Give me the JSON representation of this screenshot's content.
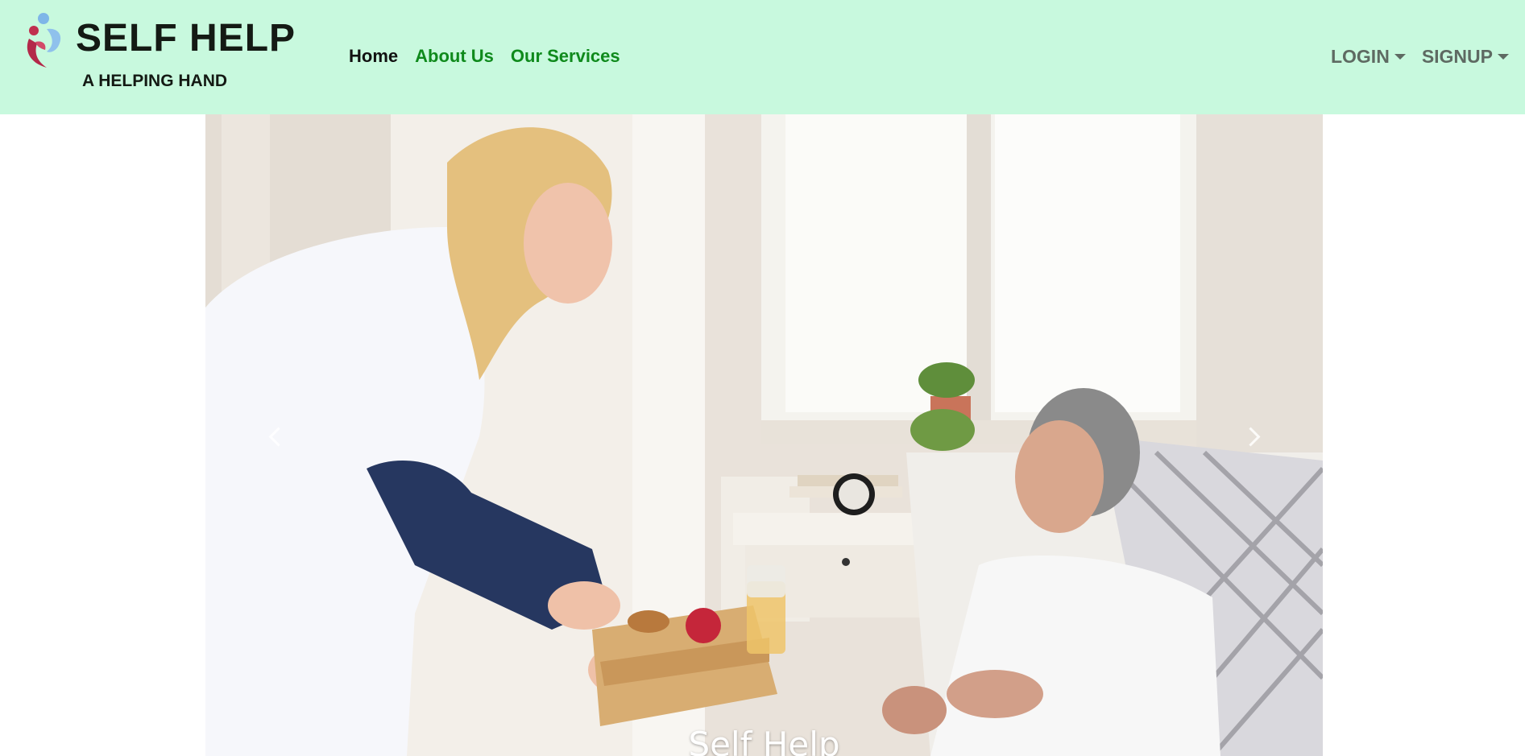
{
  "brand": {
    "title": "SELF HELP",
    "tagline": "A HELPING HAND",
    "logo_icon": "people-helping-icon"
  },
  "nav": {
    "links": [
      {
        "label": "Home",
        "active": true
      },
      {
        "label": "About Us",
        "active": false
      },
      {
        "label": "Our Services",
        "active": false
      }
    ],
    "login_label": "LOGIN",
    "signup_label": "SIGNUP"
  },
  "carousel": {
    "caption": "Self Help",
    "prev_icon": "chevron-left-icon",
    "next_icon": "chevron-right-icon",
    "image": "caregiver-serving-food-to-elderly-woman"
  },
  "colors": {
    "navbar_bg": "#c8f9de",
    "link_green": "#0f8a1c",
    "dropdown_gray": "#5e6a62"
  }
}
